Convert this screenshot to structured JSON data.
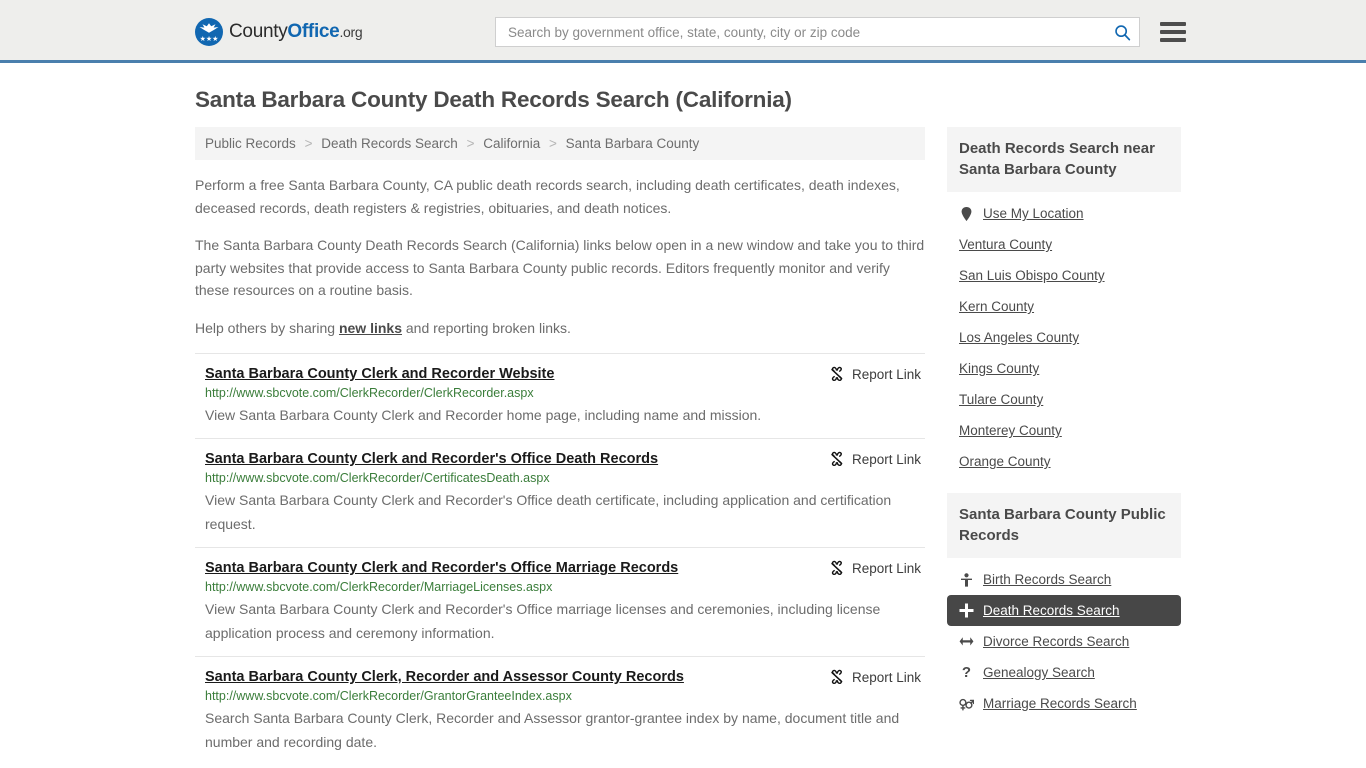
{
  "header": {
    "logo": {
      "text_county": "County",
      "text_office": "Office",
      "text_org": ".org",
      "stars": "★★★",
      "icon": "eagle-shield-logo"
    },
    "search": {
      "placeholder": "Search by government office, state, county, city or zip code",
      "value": "",
      "icon": "search-icon"
    },
    "menu_icon": "hamburger-menu-icon",
    "accent_color": "#1167b1",
    "border_color": "#4a7fad",
    "background": "#eeeeec"
  },
  "page": {
    "title": "Santa Barbara County Death Records Search (California)"
  },
  "breadcrumb": {
    "separator": ">",
    "items": [
      {
        "label": "Public Records"
      },
      {
        "label": "Death Records Search"
      },
      {
        "label": "California"
      },
      {
        "label": "Santa Barbara County"
      }
    ]
  },
  "intro": {
    "p1": "Perform a free Santa Barbara County, CA public death records search, including death certificates, death indexes, deceased records, death registers & registries, obituaries, and death notices.",
    "p2": "The Santa Barbara County Death Records Search (California) links below open in a new window and take you to third party websites that provide access to Santa Barbara County public records. Editors frequently monitor and verify these resources on a routine basis.",
    "p3_before": "Help others by sharing ",
    "p3_link": "new links",
    "p3_after": " and reporting broken links."
  },
  "results": {
    "report_label": "Report Link",
    "report_icon": "unlink-broken-chain-icon",
    "items": [
      {
        "title": "Santa Barbara County Clerk and Recorder Website",
        "url": "http://www.sbcvote.com/ClerkRecorder/ClerkRecorder.aspx",
        "description": "View Santa Barbara County Clerk and Recorder home page, including name and mission."
      },
      {
        "title": "Santa Barbara County Clerk and Recorder's Office Death Records",
        "url": "http://www.sbcvote.com/ClerkRecorder/CertificatesDeath.aspx",
        "description": "View Santa Barbara County Clerk and Recorder's Office death certificate, including application and certification request."
      },
      {
        "title": "Santa Barbara County Clerk and Recorder's Office Marriage Records",
        "url": "http://www.sbcvote.com/ClerkRecorder/MarriageLicenses.aspx",
        "description": "View Santa Barbara County Clerk and Recorder's Office marriage licenses and ceremonies, including license application process and ceremony information."
      },
      {
        "title": "Santa Barbara County Clerk, Recorder and Assessor County Records",
        "url": "http://www.sbcvote.com/ClerkRecorder/GrantorGranteeIndex.aspx",
        "description": "Search Santa Barbara County Clerk, Recorder and Assessor grantor-grantee index by name, document title and number and recording date."
      }
    ]
  },
  "sidebar": {
    "nearby": {
      "title": "Death Records Search near Santa Barbara County",
      "items": [
        {
          "label": "Use My Location",
          "icon": "map-pin-icon"
        },
        {
          "label": "Ventura County",
          "icon": ""
        },
        {
          "label": "San Luis Obispo County",
          "icon": ""
        },
        {
          "label": "Kern County",
          "icon": ""
        },
        {
          "label": "Los Angeles County",
          "icon": ""
        },
        {
          "label": "Kings County",
          "icon": ""
        },
        {
          "label": "Tulare County",
          "icon": ""
        },
        {
          "label": "Monterey County",
          "icon": ""
        },
        {
          "label": "Orange County",
          "icon": ""
        }
      ]
    },
    "public_records": {
      "title": "Santa Barbara County Public Records",
      "items": [
        {
          "label": "Birth Records Search",
          "icon": "baby-icon",
          "glyph": "👶",
          "active": false
        },
        {
          "label": "Death Records Search",
          "icon": "plus-cross-icon",
          "glyph": "✚",
          "active": true
        },
        {
          "label": "Divorce Records Search",
          "icon": "left-right-arrow-icon",
          "glyph": "↔",
          "active": false
        },
        {
          "label": "Genealogy Search",
          "icon": "question-mark-icon",
          "glyph": "?",
          "active": false
        },
        {
          "label": "Marriage Records Search",
          "icon": "male-female-icon",
          "glyph": "⚥",
          "active": false
        }
      ]
    },
    "active_bg": "#474747",
    "head_bg": "#f4f4f4"
  }
}
